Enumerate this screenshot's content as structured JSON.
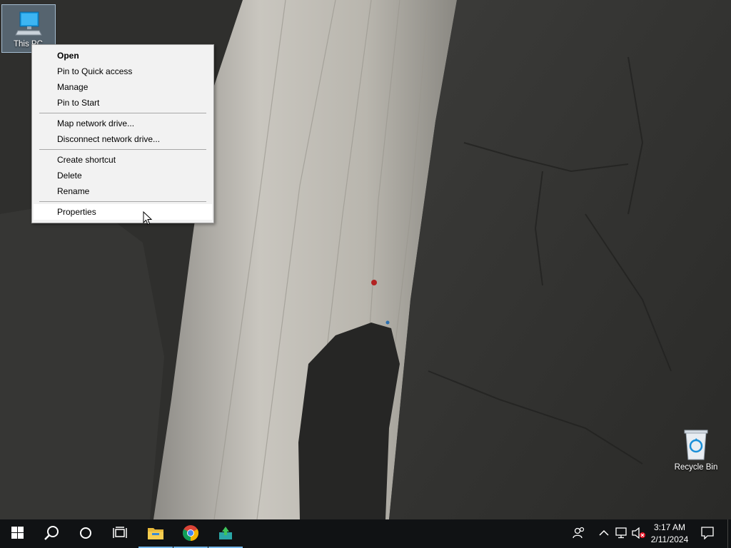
{
  "desktop": {
    "icons": [
      {
        "label": "This PC",
        "icon": "computer-icon"
      },
      {
        "label": "Recycle Bin",
        "icon": "recycle-bin-icon"
      }
    ]
  },
  "context_menu": {
    "groups": [
      [
        "Open",
        "Pin to Quick access",
        "Manage",
        "Pin to Start"
      ],
      [
        "Map network drive...",
        "Disconnect network drive..."
      ],
      [
        "Create shortcut",
        "Delete",
        "Rename"
      ],
      [
        "Properties"
      ]
    ],
    "default_item": "Open",
    "hovered_item": "Properties"
  },
  "taskbar": {
    "start": "windows-start-icon",
    "search": "search-icon",
    "cortana": "cortana-icon",
    "task_view": "task-view-icon",
    "pinned": [
      {
        "name": "File Explorer",
        "icon": "file-explorer-icon",
        "active": true
      },
      {
        "name": "Google Chrome",
        "icon": "chrome-icon",
        "active": true
      },
      {
        "name": "App",
        "icon": "app-download-icon",
        "active": true
      }
    ],
    "tray": [
      "people-icon",
      "chevron-up-icon",
      "network-icon",
      "volume-muted-icon"
    ],
    "clock": {
      "time": "3:17 AM",
      "date": "2/11/2024"
    },
    "notifications": "action-center-icon"
  },
  "colors": {
    "taskbar": "#101214",
    "accent": "#76b9ed",
    "menu_bg": "#f2f2f2"
  }
}
